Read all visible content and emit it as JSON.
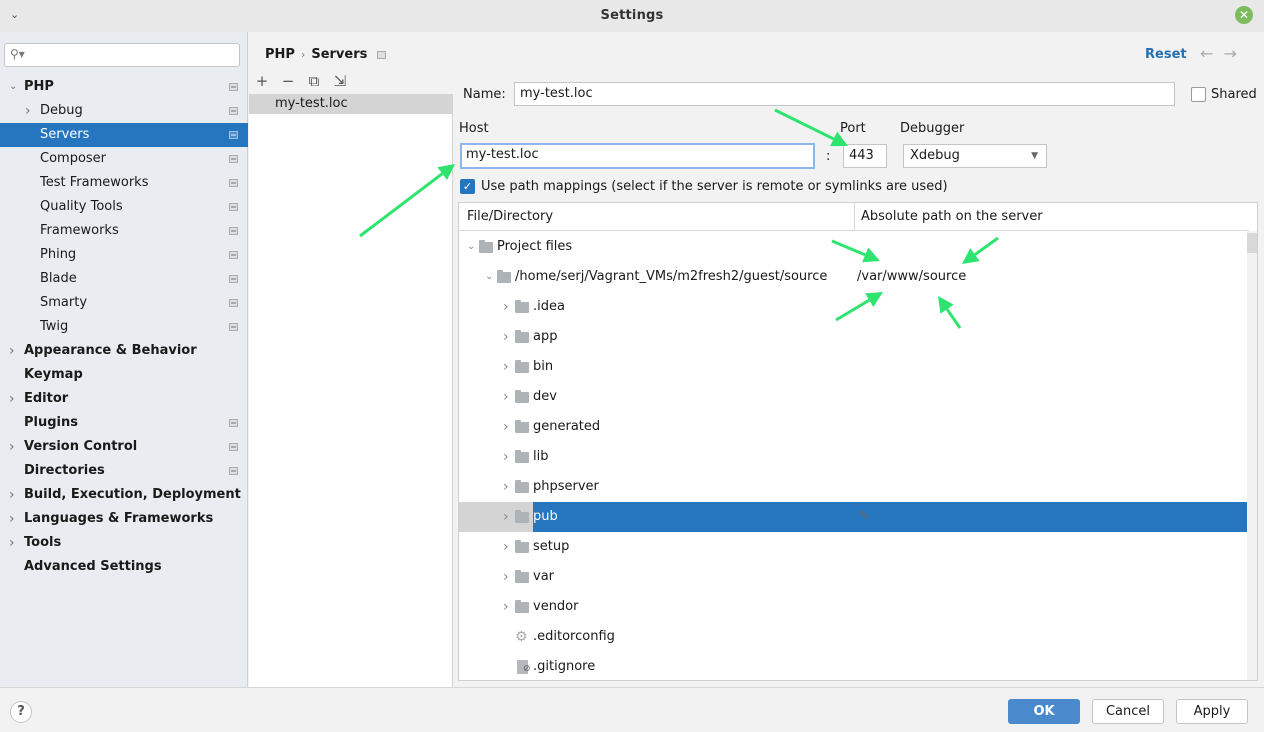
{
  "window": {
    "title": "Settings",
    "close_icon": "close-icon",
    "collapse_icon": "chevron-down-icon"
  },
  "sidebar": {
    "search_placeholder": "",
    "items": [
      {
        "label": "PHP",
        "level": 0,
        "bold": true,
        "expandable": true,
        "expanded": true,
        "project_icon": true
      },
      {
        "label": "Debug",
        "level": 1,
        "bold": false,
        "expandable": true,
        "expanded": false,
        "project_icon": true
      },
      {
        "label": "Servers",
        "level": 1,
        "bold": false,
        "expandable": false,
        "selected": true,
        "project_icon": true
      },
      {
        "label": "Composer",
        "level": 1,
        "bold": false,
        "expandable": false,
        "project_icon": true
      },
      {
        "label": "Test Frameworks",
        "level": 1,
        "bold": false,
        "expandable": false,
        "project_icon": true
      },
      {
        "label": "Quality Tools",
        "level": 1,
        "bold": false,
        "expandable": false,
        "project_icon": true
      },
      {
        "label": "Frameworks",
        "level": 1,
        "bold": false,
        "expandable": false,
        "project_icon": true
      },
      {
        "label": "Phing",
        "level": 1,
        "bold": false,
        "expandable": false,
        "project_icon": true
      },
      {
        "label": "Blade",
        "level": 1,
        "bold": false,
        "expandable": false,
        "project_icon": true
      },
      {
        "label": "Smarty",
        "level": 1,
        "bold": false,
        "expandable": false,
        "project_icon": true
      },
      {
        "label": "Twig",
        "level": 1,
        "bold": false,
        "expandable": false,
        "project_icon": true
      },
      {
        "label": "Appearance & Behavior",
        "level": 0,
        "bold": true,
        "expandable": true,
        "project_icon": false
      },
      {
        "label": "Keymap",
        "level": 0,
        "bold": true,
        "expandable": false,
        "project_icon": false
      },
      {
        "label": "Editor",
        "level": 0,
        "bold": true,
        "expandable": true,
        "project_icon": false
      },
      {
        "label": "Plugins",
        "level": 0,
        "bold": true,
        "expandable": false,
        "project_icon": true
      },
      {
        "label": "Version Control",
        "level": 0,
        "bold": true,
        "expandable": true,
        "project_icon": true
      },
      {
        "label": "Directories",
        "level": 0,
        "bold": true,
        "expandable": false,
        "project_icon": true
      },
      {
        "label": "Build, Execution, Deployment",
        "level": 0,
        "bold": true,
        "expandable": true,
        "project_icon": false
      },
      {
        "label": "Languages & Frameworks",
        "level": 0,
        "bold": true,
        "expandable": true,
        "project_icon": false
      },
      {
        "label": "Tools",
        "level": 0,
        "bold": true,
        "expandable": true,
        "project_icon": false
      },
      {
        "label": "Advanced Settings",
        "level": 0,
        "bold": true,
        "expandable": false,
        "project_icon": false
      }
    ]
  },
  "header": {
    "breadcrumb": [
      "PHP",
      "Servers"
    ],
    "reset_label": "Reset",
    "back_icon": "←",
    "forward_icon": "→"
  },
  "servers": {
    "toolbar": {
      "add": "+",
      "remove": "−",
      "copy": "⧉",
      "import": "⇲"
    },
    "items": [
      "my-test.loc"
    ]
  },
  "form": {
    "name_label": "Name:",
    "name_value": "my-test.loc",
    "shared_label": "Shared",
    "shared_checked": false,
    "host_label": "Host",
    "host_value": "my-test.loc",
    "port_separator": ":",
    "port_label": "Port",
    "port_value": "443",
    "debugger_label": "Debugger",
    "debugger_value": "Xdebug",
    "path_mappings_label": "Use path mappings (select if the server is remote or symlinks are used)",
    "path_mappings_checked": true
  },
  "mappings": {
    "columns": [
      "File/Directory",
      "Absolute path on the server"
    ],
    "rows": [
      {
        "name": "Project files",
        "depth": 0,
        "type": "folder",
        "expanded": true,
        "remote": ""
      },
      {
        "name": "/home/serj/Vagrant_VMs/m2fresh2/guest/source",
        "depth": 1,
        "type": "folder",
        "expanded": true,
        "remote": "/var/www/source"
      },
      {
        "name": ".idea",
        "depth": 2,
        "type": "folder",
        "expanded": false,
        "remote": ""
      },
      {
        "name": "app",
        "depth": 2,
        "type": "folder",
        "expanded": false,
        "remote": ""
      },
      {
        "name": "bin",
        "depth": 2,
        "type": "folder",
        "expanded": false,
        "remote": ""
      },
      {
        "name": "dev",
        "depth": 2,
        "type": "folder",
        "expanded": false,
        "remote": ""
      },
      {
        "name": "generated",
        "depth": 2,
        "type": "folder",
        "expanded": false,
        "remote": ""
      },
      {
        "name": "lib",
        "depth": 2,
        "type": "folder",
        "expanded": false,
        "remote": ""
      },
      {
        "name": "phpserver",
        "depth": 2,
        "type": "folder",
        "expanded": false,
        "remote": ""
      },
      {
        "name": "pub",
        "depth": 2,
        "type": "folder",
        "expanded": false,
        "remote": "",
        "selected": true
      },
      {
        "name": "setup",
        "depth": 2,
        "type": "folder",
        "expanded": false,
        "remote": ""
      },
      {
        "name": "var",
        "depth": 2,
        "type": "folder",
        "expanded": false,
        "remote": ""
      },
      {
        "name": "vendor",
        "depth": 2,
        "type": "folder",
        "expanded": false,
        "remote": ""
      },
      {
        "name": ".editorconfig",
        "depth": 2,
        "type": "config-file",
        "remote": ""
      },
      {
        "name": ".gitignore",
        "depth": 2,
        "type": "ignore-file",
        "remote": ""
      }
    ]
  },
  "footer": {
    "help_label": "?",
    "ok_label": "OK",
    "cancel_label": "Cancel",
    "apply_label": "Apply"
  },
  "annotation_color": "#2ee36e"
}
